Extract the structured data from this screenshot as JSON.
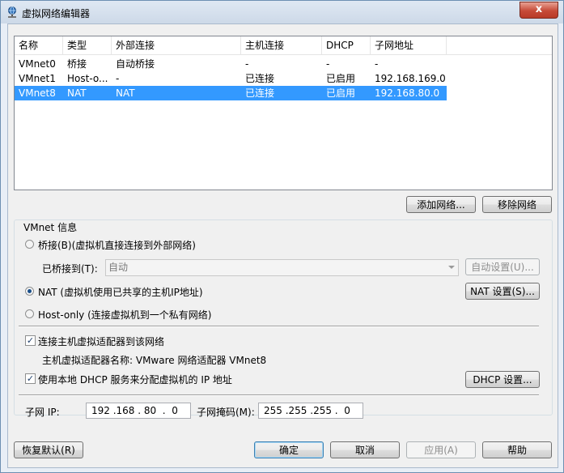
{
  "window": {
    "title": "虚拟网络编辑器",
    "close_label": "x"
  },
  "network_list": {
    "columns": [
      "名称",
      "类型",
      "外部连接",
      "主机连接",
      "DHCP",
      "子网地址"
    ],
    "rows": [
      {
        "name": "VMnet0",
        "type": "桥接",
        "external": "自动桥接",
        "host": "-",
        "dhcp": "-",
        "subnet": "-",
        "selected": false
      },
      {
        "name": "VMnet1",
        "type": "Host-o...",
        "external": "-",
        "host": "已连接",
        "dhcp": "已启用",
        "subnet": "192.168.169.0",
        "selected": false
      },
      {
        "name": "VMnet8",
        "type": "NAT",
        "external": "NAT",
        "host": "已连接",
        "dhcp": "已启用",
        "subnet": "192.168.80.0",
        "selected": true
      }
    ]
  },
  "list_buttons": {
    "add_network": "添加网络...",
    "remove_network": "移除网络"
  },
  "vmnet_info": {
    "label": "VMnet 信息",
    "bridged_option": "桥接(B)(虚拟机直接连接到外部网络)",
    "bridged_to_label": "已桥接到(T):",
    "bridged_to_value": "自动",
    "auto_settings": "自动设置(U)...",
    "nat_option": "NAT (虚拟机使用已共享的主机IP地址)",
    "nat_settings": "NAT 设置(S)...",
    "hostonly_option": "Host-only (连接虚拟机到一个私有网络)",
    "connect_adapter": "连接主机虚拟适配器到该网络",
    "adapter_name": "主机虚拟适配器名称: VMware 网络适配器 VMnet8",
    "use_dhcp": "使用本地 DHCP 服务来分配虚拟机的 IP 地址",
    "dhcp_settings": "DHCP 设置...",
    "subnet_ip_label": "子网 IP:",
    "subnet_ip_value": "192 .168 . 80  .  0",
    "subnet_mask_label": "子网掩码(M):",
    "subnet_mask_value": "255 .255 .255 .  0"
  },
  "bottom_buttons": {
    "restore": "恢复默认(R)",
    "ok": "确定",
    "cancel": "取消",
    "apply": "应用(A)",
    "help": "帮助"
  },
  "colors": {
    "selection": "#3399ff",
    "titlebar": "#dfe8f3",
    "close": "#c64a37"
  }
}
